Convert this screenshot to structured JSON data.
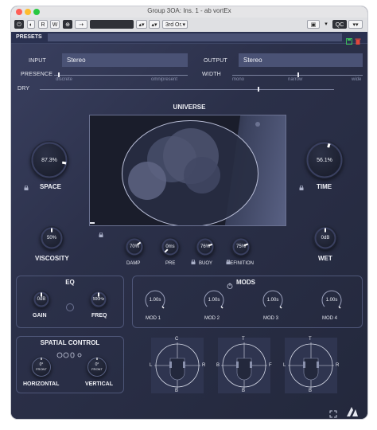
{
  "window": {
    "title": "Group 3OA: Ins. 1 - ab vortEx"
  },
  "host_toolbar": {
    "power_label": "⏻",
    "read_label": "R",
    "write_label": "W",
    "bypass_label": "⊕",
    "sidechain_label": "⇢",
    "preset_field": "",
    "order_select": "3rd Or.",
    "camera_label": "📷",
    "qc_label": "QC"
  },
  "presets": {
    "label": "PRESETS",
    "value": ""
  },
  "io": {
    "input_label": "INPUT",
    "input_value": "Stereo",
    "output_label": "OUTPUT",
    "output_value": "Stereo"
  },
  "presence": {
    "label": "PRESENCE",
    "min_label": "discrete",
    "max_label": "omnipresent",
    "level": 0.03
  },
  "width": {
    "label": "WIDTH",
    "min_label": "mono",
    "mid_label": "narrow",
    "max_label": "wide",
    "level": 0.5
  },
  "dry": {
    "label": "DRY",
    "level": 0.74
  },
  "universe": {
    "title": "UNIVERSE"
  },
  "knobs": {
    "space": {
      "label": "SPACE",
      "value": "87.3%",
      "level": 0.873
    },
    "time": {
      "label": "TIME",
      "value": "56.1%",
      "level": 0.561
    },
    "viscosity": {
      "label": "VISCOSITY",
      "value": "50%",
      "level": 0.5
    },
    "wet": {
      "label": "WET",
      "value": "0dB",
      "level": 0.5
    },
    "damp": {
      "label": "DAMP",
      "value": "70%",
      "level": 0.7
    },
    "pre": {
      "label": "PRE",
      "value": "0ms",
      "level": 0.0
    },
    "buoy": {
      "label": "BUOY",
      "value": "76%",
      "level": 0.76
    },
    "definition": {
      "label": "DEFINITION",
      "value": "75%",
      "level": 0.75
    }
  },
  "eq": {
    "title": "EQ",
    "gain": {
      "label": "GAIN",
      "value": "0dB",
      "level": 0.5
    },
    "freq": {
      "label": "FREQ",
      "value": "500Hz",
      "level": 0.5
    }
  },
  "mods": {
    "title": "MODS",
    "items": [
      {
        "label": "MOD 1",
        "value": "1.00s"
      },
      {
        "label": "MOD 2",
        "value": "1.00s"
      },
      {
        "label": "MOD 3",
        "value": "1.00s"
      },
      {
        "label": "MOD 4",
        "value": "1.00s"
      }
    ]
  },
  "spatial": {
    "title": "SPATIAL CONTROL",
    "horizontal": {
      "label": "HORIZONTAL",
      "value": "0°",
      "sub": "FRONT"
    },
    "vertical": {
      "label": "VERTICAL",
      "value": "0°",
      "sub": "FRONT"
    }
  },
  "scopes": [
    {
      "top": "C",
      "left": "L",
      "right": "R",
      "bottom": "B"
    },
    {
      "top": "T",
      "left": "B",
      "right": "F",
      "bottom": "B"
    },
    {
      "top": "T",
      "left": "L",
      "right": "R",
      "bottom": "B"
    }
  ],
  "colors": {
    "accent": "#ffffff",
    "panel_bg": "#2b3049",
    "field_bg": "#4a5275"
  }
}
